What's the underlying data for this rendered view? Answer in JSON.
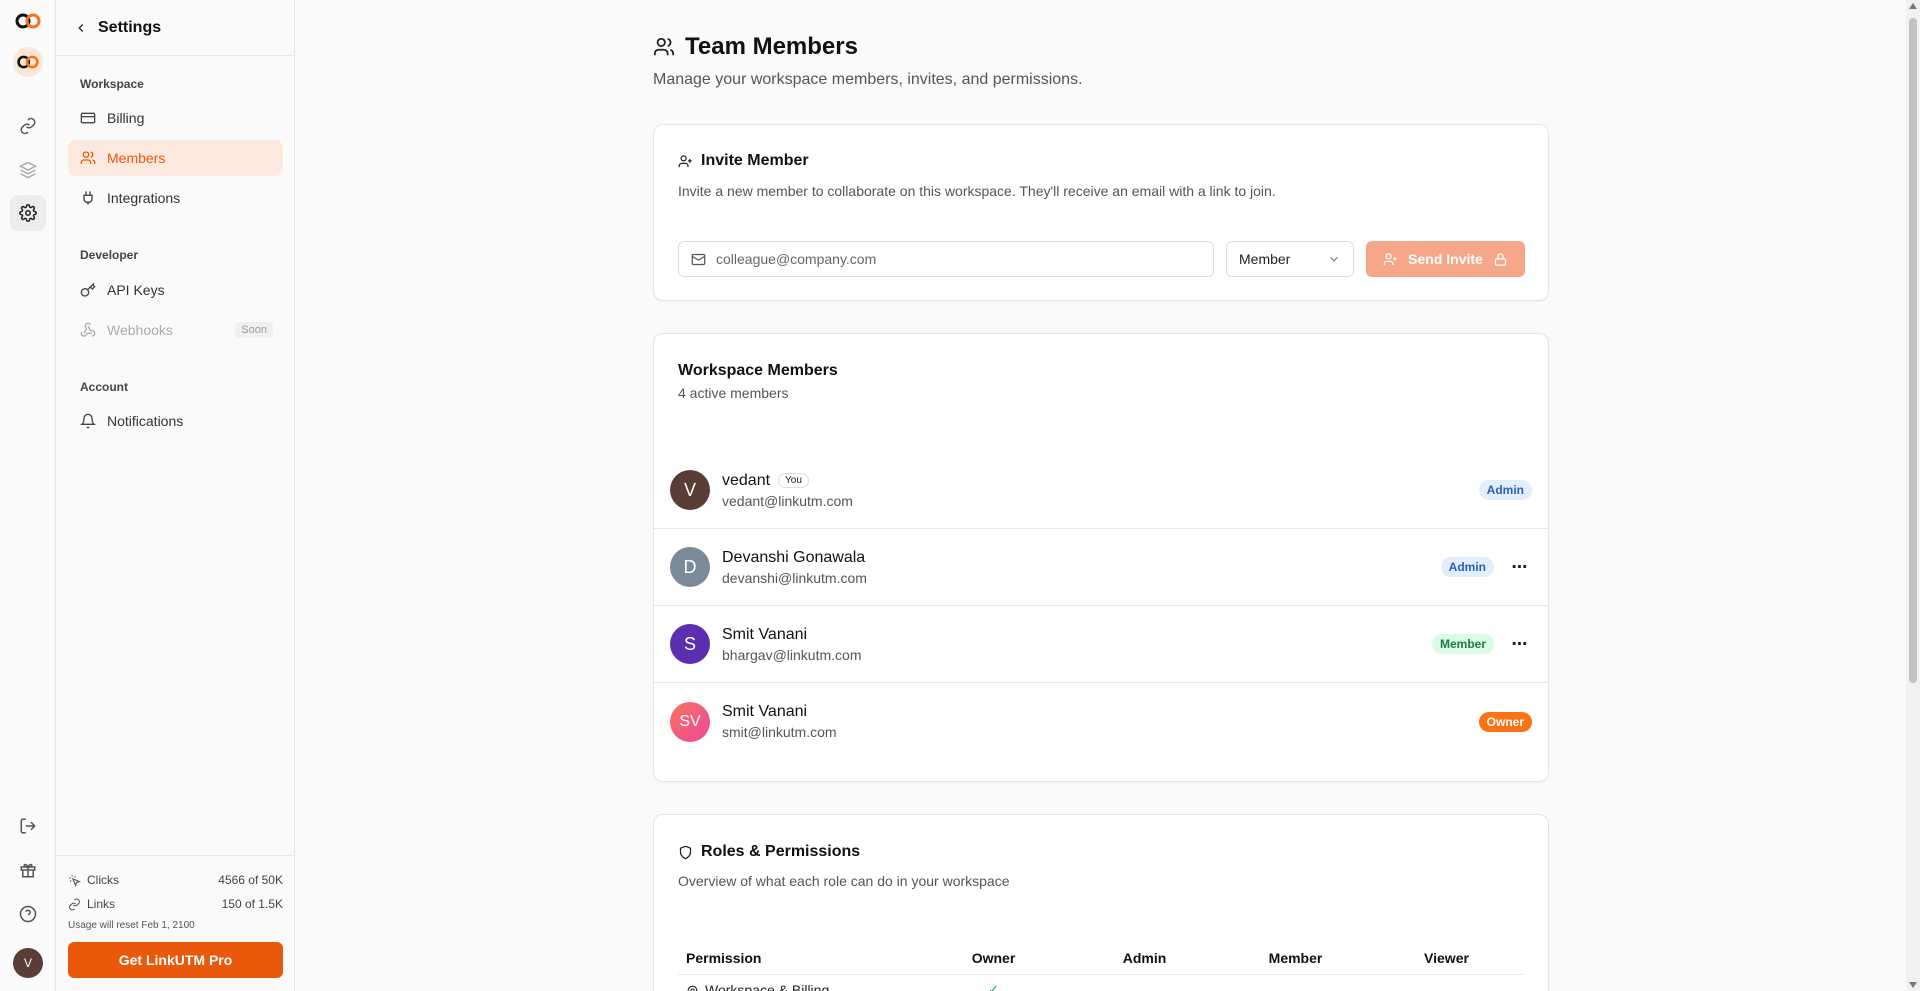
{
  "sidebar": {
    "title": "Settings",
    "sections": [
      {
        "label": "Workspace",
        "items": [
          {
            "label": "Billing",
            "icon": "credit-card-icon"
          },
          {
            "label": "Members",
            "icon": "users-icon",
            "active": true
          },
          {
            "label": "Integrations",
            "icon": "plug-icon"
          }
        ]
      },
      {
        "label": "Developer",
        "items": [
          {
            "label": "API Keys",
            "icon": "key-icon"
          },
          {
            "label": "Webhooks",
            "icon": "webhook-icon",
            "badge": "Soon",
            "disabled": true
          }
        ]
      },
      {
        "label": "Account",
        "items": [
          {
            "label": "Notifications",
            "icon": "bell-icon"
          }
        ]
      }
    ],
    "usage": {
      "clicks_label": "Clicks",
      "clicks_value": "4566 of 50K",
      "links_label": "Links",
      "links_value": "150 of 1.5K",
      "reset_note": "Usage will reset Feb 1, 2100"
    },
    "pro_button": "Get LinkUTM Pro"
  },
  "rail": {
    "avatar_initial": "V"
  },
  "page": {
    "title": "Team Members",
    "subtitle": "Manage your workspace members, invites, and permissions."
  },
  "invite": {
    "title": "Invite Member",
    "description": "Invite a new member to collaborate on this workspace. They'll receive an email with a link to join.",
    "email_placeholder": "colleague@company.com",
    "role_value": "Member",
    "send_label": "Send Invite"
  },
  "members": {
    "title": "Workspace Members",
    "count_text": "4 active members",
    "list": [
      {
        "initial": "V",
        "name": "vedant",
        "you": "You",
        "email": "vedant@linkutm.com",
        "role": "Admin",
        "avatar_color": "#5a3e36"
      },
      {
        "initial": "D",
        "name": "Devanshi Gonawala",
        "email": "devanshi@linkutm.com",
        "role": "Admin",
        "avatar_color": "#7b8a98"
      },
      {
        "initial": "S",
        "name": "Smit Vanani",
        "email": "bhargav@linkutm.com",
        "role": "Member",
        "avatar_color": "#5b2fb0"
      },
      {
        "initial": "SV",
        "name": "Smit Vanani",
        "email": "smit@linkutm.com",
        "role": "Owner",
        "avatar_color": "#f0566e"
      }
    ]
  },
  "roles": {
    "title": "Roles & Permissions",
    "description": "Overview of what each role can do in your workspace",
    "headers": [
      "Permission",
      "Owner",
      "Admin",
      "Member",
      "Viewer"
    ],
    "rows": [
      {
        "label": "Workspace & Billing",
        "owner": "✓",
        "admin": "⌄",
        "member": "⌄",
        "viewer": "⌄"
      }
    ]
  }
}
